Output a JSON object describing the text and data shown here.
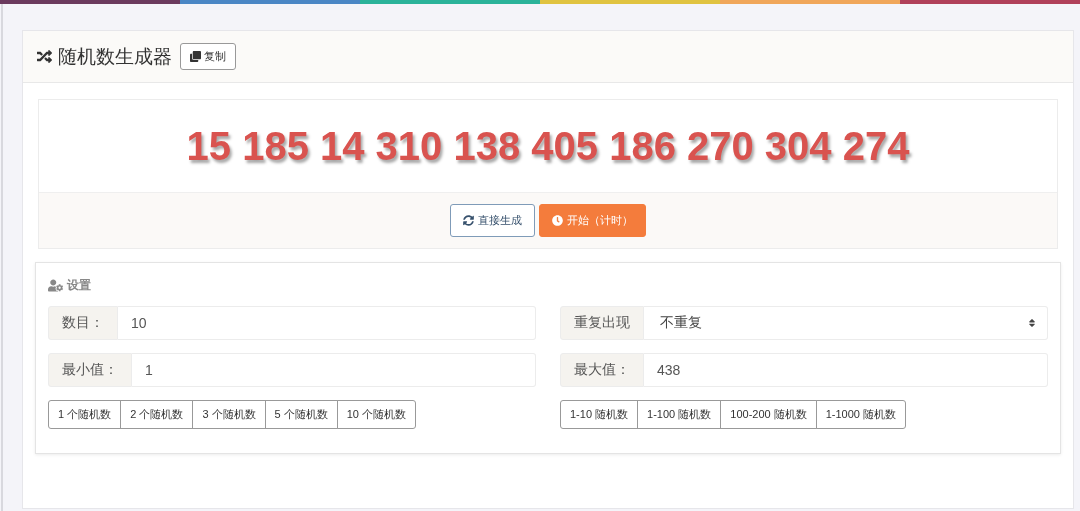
{
  "header": {
    "title": "随机数生成器",
    "copy_button": "复制"
  },
  "result": {
    "numbers": "15 185 14 310 138 405 186 270 304 274"
  },
  "actions": [
    {
      "label": "直接生成",
      "kind": "outline"
    },
    {
      "label": "开始（计时）",
      "kind": "primary"
    }
  ],
  "settings": {
    "title": "设置",
    "fields": [
      {
        "label": "数目：",
        "value": "10",
        "kind": "input"
      },
      {
        "label": "重复出现",
        "value": "不重复",
        "kind": "select"
      },
      {
        "label": "最小值：",
        "value": "1",
        "kind": "input"
      },
      {
        "label": "最大值：",
        "value": "438",
        "kind": "input"
      }
    ],
    "count_presets": [
      "1 个随机数",
      "2 个随机数",
      "3 个随机数",
      "5 个随机数",
      "10 个随机数"
    ],
    "range_presets": [
      "1-10 随机数",
      "1-100 随机数",
      "100-200 随机数",
      "1-1000 随机数"
    ]
  }
}
